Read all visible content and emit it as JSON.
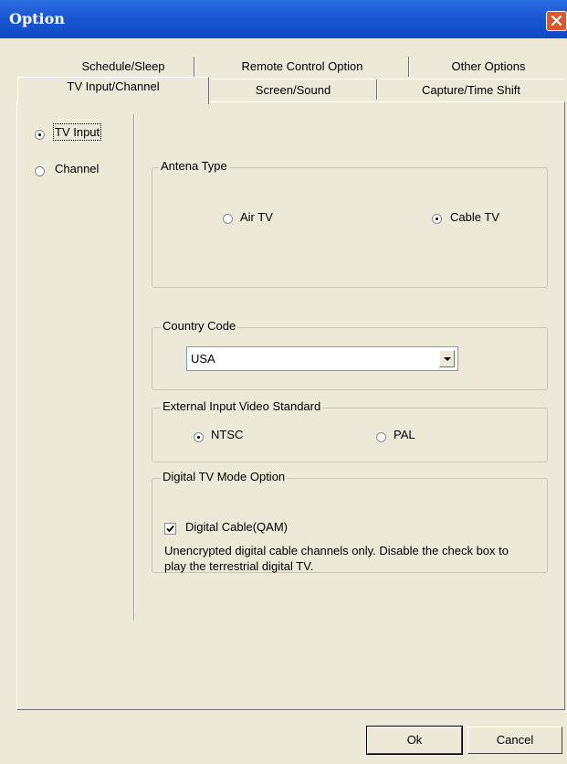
{
  "window": {
    "title": "Option"
  },
  "tabs": {
    "row1": [
      {
        "label": "Schedule/Sleep"
      },
      {
        "label": "Remote Control Option"
      },
      {
        "label": "Other Options"
      }
    ],
    "row2": [
      {
        "label": "TV Input/Channel",
        "active": true
      },
      {
        "label": "Screen/Sound"
      },
      {
        "label": "Capture/Time Shift"
      }
    ]
  },
  "left_nav": {
    "tv_input": {
      "label": "TV Input",
      "checked": true
    },
    "channel": {
      "label": "Channel",
      "checked": false
    }
  },
  "antenna": {
    "title": "Antena Type",
    "air": {
      "label": "Air TV",
      "checked": false
    },
    "cable": {
      "label": "Cable TV",
      "checked": true
    }
  },
  "country": {
    "title": "Country Code",
    "selected": "USA"
  },
  "video_standard": {
    "title": "External Input Video Standard",
    "ntsc": {
      "label": "NTSC",
      "checked": true
    },
    "pal": {
      "label": "PAL",
      "checked": false
    }
  },
  "digital_tv": {
    "title": "Digital TV Mode Option",
    "checkbox_label": "Digital Cable(QAM)",
    "checked": true,
    "description": "Unencrypted digital cable channels only. Disable the check box to play the terrestrial digital TV."
  },
  "buttons": {
    "ok": "Ok",
    "cancel": "Cancel"
  }
}
